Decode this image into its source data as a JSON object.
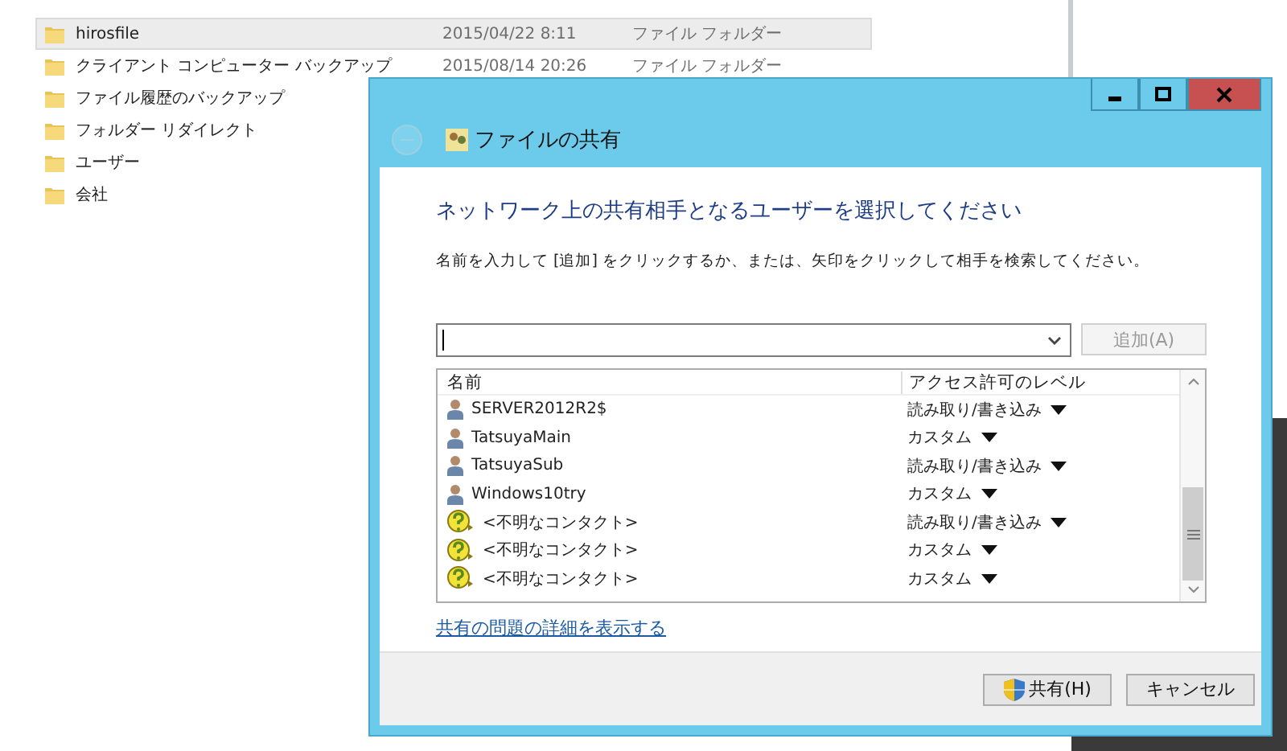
{
  "explorer": {
    "rows": [
      {
        "name": "hirosfile",
        "date": "2015/04/22 8:11",
        "type": "ファイル フォルダー",
        "selected": true
      },
      {
        "name": "クライアント コンピューター バックアップ",
        "date": "2015/08/14 20:26",
        "type": "ファイル フォルダー",
        "selected": false
      },
      {
        "name": "ファイル履歴のバックアップ",
        "selected": false
      },
      {
        "name": "フォルダー リダイレクト",
        "selected": false
      },
      {
        "name": "ユーザー",
        "selected": false
      },
      {
        "name": "会社",
        "selected": false
      }
    ]
  },
  "dialog": {
    "title": "ファイルの共有",
    "heading": "ネットワーク上の共有相手となるユーザーを選択してください",
    "instruction": "名前を入力して [追加] をクリックするか、または、矢印をクリックして相手を検索してください。",
    "add_button": {
      "label": "追加(A)",
      "disabled": true
    },
    "list": {
      "columns": [
        "名前",
        "アクセス許可のレベル"
      ],
      "rows": [
        {
          "kind": "user",
          "name": "SERVER2012R2$",
          "access": "読み取り/書き込み"
        },
        {
          "kind": "user",
          "name": "TatsuyaMain",
          "access": "カスタム"
        },
        {
          "kind": "user",
          "name": "TatsuyaSub",
          "access": "読み取り/書き込み"
        },
        {
          "kind": "user",
          "name": "Windows10try",
          "access": "カスタム"
        },
        {
          "kind": "unknown",
          "name": "<不明なコンタクト>",
          "access": "読み取り/書き込み"
        },
        {
          "kind": "unknown",
          "name": "<不明なコンタクト>",
          "access": "カスタム"
        },
        {
          "kind": "unknown",
          "name": "<不明なコンタクト>",
          "access": "カスタム"
        }
      ]
    },
    "link": "共有の問題の詳細を表示する",
    "buttons": [
      {
        "label": "共有(H)",
        "kind": "shield"
      },
      {
        "label": "キャンセル",
        "kind": "plain"
      }
    ]
  }
}
